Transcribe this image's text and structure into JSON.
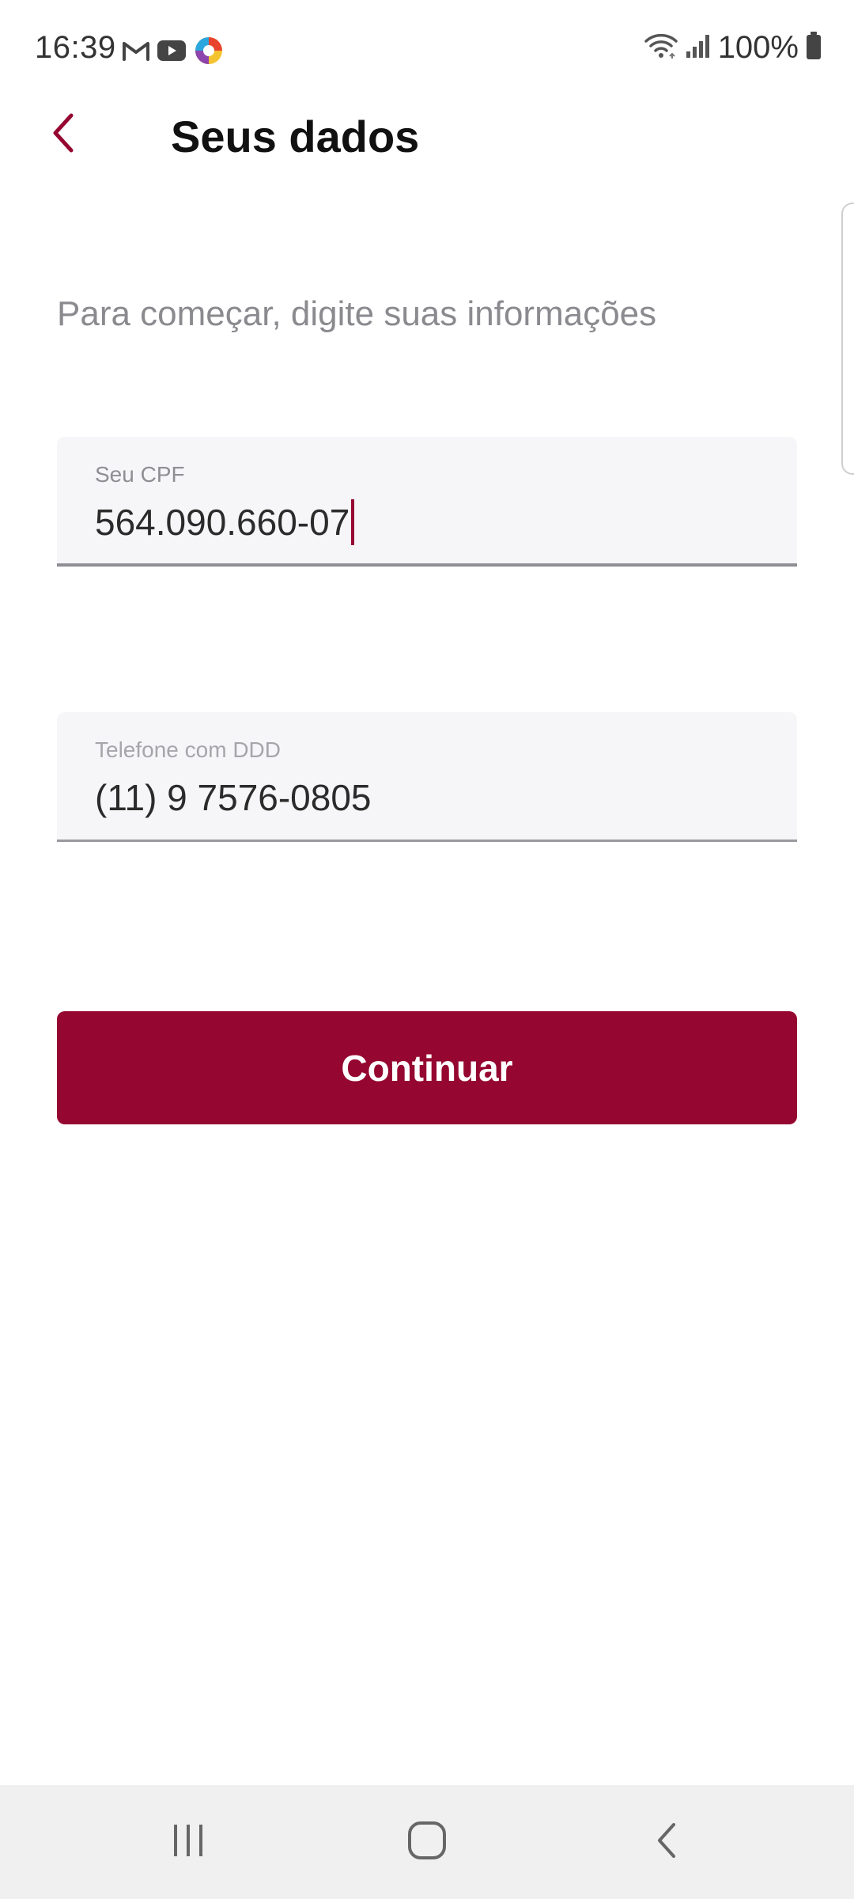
{
  "status_bar": {
    "time": "16:39",
    "battery_percent": "100%",
    "left_icons": [
      "gmail-icon",
      "youtube-icon",
      "app-logo-icon"
    ],
    "right_icons": [
      "wifi-icon",
      "signal-icon",
      "battery-icon"
    ]
  },
  "header": {
    "title": "Seus dados",
    "back_icon": "chevron-left-icon"
  },
  "form": {
    "subtitle": "Para começar, digite suas informações",
    "cpf": {
      "label": "Seu CPF",
      "value": "564.090.660-07",
      "focused": true
    },
    "phone": {
      "label": "Telefone com DDD",
      "value": "(11) 9 7576-0805"
    },
    "continue_label": "Continuar"
  },
  "nav_bar": {
    "recents_icon": "recents-icon",
    "home_icon": "home-icon",
    "back_icon": "back-icon"
  },
  "colors": {
    "accent": "#950730",
    "field_background": "#f6f6f8",
    "subtitle_text": "#8a8a8f",
    "nav_background": "#f0f0f0"
  }
}
